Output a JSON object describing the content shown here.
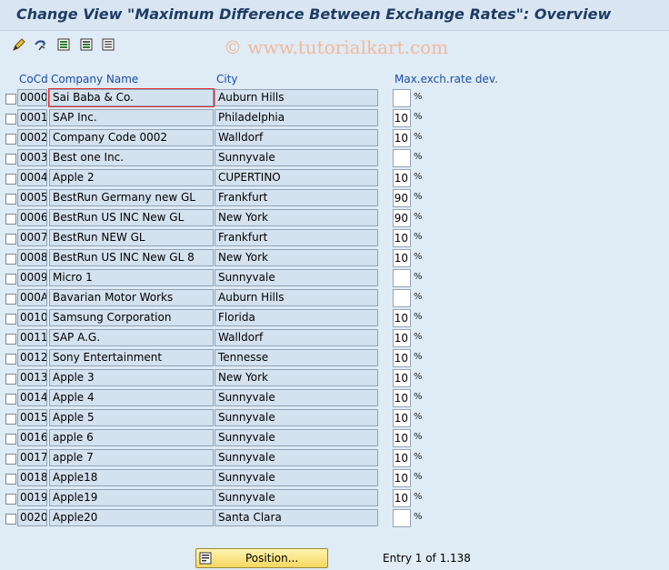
{
  "title": "Change View \"Maximum Difference Between Exchange Rates\": Overview",
  "watermark": "© www.tutorialkart.com",
  "toolbar": {
    "icons": [
      "edit-icon",
      "display-change-icon",
      "select-all-icon",
      "select-block-icon",
      "deselect-all-icon"
    ]
  },
  "columns": {
    "cocd": "CoCd",
    "company": "Company Name",
    "city": "City",
    "dev": "Max.exch.rate dev."
  },
  "percent_sign": "%",
  "rows": [
    {
      "cocd": "0000",
      "company": "Sai Baba & Co.",
      "city": "Auburn Hills",
      "dev": ""
    },
    {
      "cocd": "0001",
      "company": "SAP Inc.",
      "city": "Philadelphia",
      "dev": "10"
    },
    {
      "cocd": "0002",
      "company": "Company Code 0002",
      "city": "Walldorf",
      "dev": "10"
    },
    {
      "cocd": "0003",
      "company": "Best one Inc.",
      "city": "Sunnyvale",
      "dev": ""
    },
    {
      "cocd": "0004",
      "company": "Apple 2",
      "city": "CUPERTINO",
      "dev": "10"
    },
    {
      "cocd": "0005",
      "company": "BestRun Germany new GL",
      "city": "Frankfurt",
      "dev": "90"
    },
    {
      "cocd": "0006",
      "company": "BestRun US INC New GL",
      "city": "New York",
      "dev": "90"
    },
    {
      "cocd": "0007",
      "company": "BestRun NEW GL",
      "city": "Frankfurt",
      "dev": "10"
    },
    {
      "cocd": "0008",
      "company": "BestRun US INC New GL 8",
      "city": "New York",
      "dev": "10"
    },
    {
      "cocd": "0009",
      "company": "Micro 1",
      "city": "Sunnyvale",
      "dev": ""
    },
    {
      "cocd": "000A",
      "company": "Bavarian Motor Works",
      "city": "Auburn Hills",
      "dev": ""
    },
    {
      "cocd": "0010",
      "company": "Samsung Corporation",
      "city": "Florida",
      "dev": "10"
    },
    {
      "cocd": "0011",
      "company": "SAP A.G.",
      "city": "Walldorf",
      "dev": "10"
    },
    {
      "cocd": "0012",
      "company": "Sony Entertainment",
      "city": "Tennesse",
      "dev": "10"
    },
    {
      "cocd": "0013",
      "company": "Apple 3",
      "city": "New York",
      "dev": "10"
    },
    {
      "cocd": "0014",
      "company": "Apple 4",
      "city": "Sunnyvale",
      "dev": "10"
    },
    {
      "cocd": "0015",
      "company": "Apple 5",
      "city": "Sunnyvale",
      "dev": "10"
    },
    {
      "cocd": "0016",
      "company": "apple 6",
      "city": "Sunnyvale",
      "dev": "10"
    },
    {
      "cocd": "0017",
      "company": "apple 7",
      "city": "Sunnyvale",
      "dev": "10"
    },
    {
      "cocd": "0018",
      "company": "Apple18",
      "city": "Sunnyvale",
      "dev": "10"
    },
    {
      "cocd": "0019",
      "company": "Apple19",
      "city": "Sunnyvale",
      "dev": "10"
    },
    {
      "cocd": "0020",
      "company": "Apple20",
      "city": "Santa Clara",
      "dev": ""
    }
  ],
  "footer": {
    "position_button": "Position...",
    "entry_text": "Entry 1 of 1.138"
  }
}
